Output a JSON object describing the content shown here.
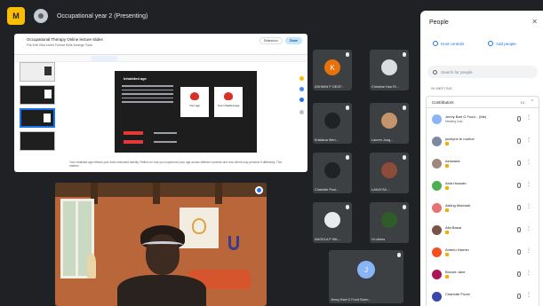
{
  "meeting": {
    "title": "Occupational year 2 (Presenting)"
  },
  "shared_doc": {
    "title": "Occupational Therapy Online lecture slides",
    "menu": "File  Edit  View  Insert  Format  Slide  Arrange  Tools",
    "slideshow_label": "Slideshow",
    "share_label": "Share",
    "slide": {
      "heading": "Inhabited age",
      "card1_caption": "Your age",
      "card2_caption": "Your inhabited age"
    },
    "notes": "Your inhabited age reflects your lived embodied identity. Reflect on how you experience your age across different contexts and how others may perceive it differently. This matters."
  },
  "tiles": [
    {
      "name": "ASHWIN P GEOF...",
      "letter": "K",
      "color": "#e8710a"
    },
    {
      "name": "Christine Han Ri...",
      "letter": "",
      "color": "#5f6368"
    },
    {
      "name": "Kristiana Wen...",
      "letter": "",
      "color": "#5f6368"
    },
    {
      "name": "Lauren Jung...",
      "letter": "",
      "color": "#c5946b"
    },
    {
      "name": "Charlotte Pool...",
      "letter": "",
      "color": "#5f6368"
    },
    {
      "name": "LAKAYSA ...",
      "letter": "",
      "color": "#8d4b3a"
    },
    {
      "name": "ANGELA P WIL...",
      "letter": "",
      "color": "#e8eaed"
    },
    {
      "name": "Hi others",
      "letter": "",
      "color": "#2f5d2a"
    },
    {
      "name": "Jenny Bart G Food Scien...",
      "letter": "J",
      "color": "#8ab4f8"
    }
  ],
  "people_panel": {
    "title": "People",
    "add_people_label": "Add people",
    "host_controls_label": "Host controls",
    "search_placeholder": "Search for people",
    "section_label": "IN MEETING",
    "group_label": "Contributors",
    "group_count": "14",
    "participants": [
      {
        "name": "Jenny Bart G Food... (Me)",
        "sub": "Meeting host",
        "color": "#8ab4f8",
        "hand": false
      },
      {
        "name": "jocelyne te roohue",
        "sub": "",
        "color": "#7b8a9e",
        "hand": true
      },
      {
        "name": "Ashwaria",
        "sub": "",
        "color": "#a1887f",
        "hand": true
      },
      {
        "name": "Aida Hussain",
        "sub": "",
        "color": "#4caf50",
        "hand": true
      },
      {
        "name": "Aisling Machadi",
        "sub": "",
        "color": "#e57373",
        "hand": true
      },
      {
        "name": "Alla Basat",
        "sub": "",
        "color": "#795548",
        "hand": true
      },
      {
        "name": "Ambriu Harmin",
        "sub": "",
        "color": "#f4511e",
        "hand": true
      },
      {
        "name": "Brooke Jane",
        "sub": "",
        "color": "#ad1457",
        "hand": true
      },
      {
        "name": "Charlotte Pooer",
        "sub": "",
        "color": "#3949ab",
        "hand": false
      }
    ]
  }
}
